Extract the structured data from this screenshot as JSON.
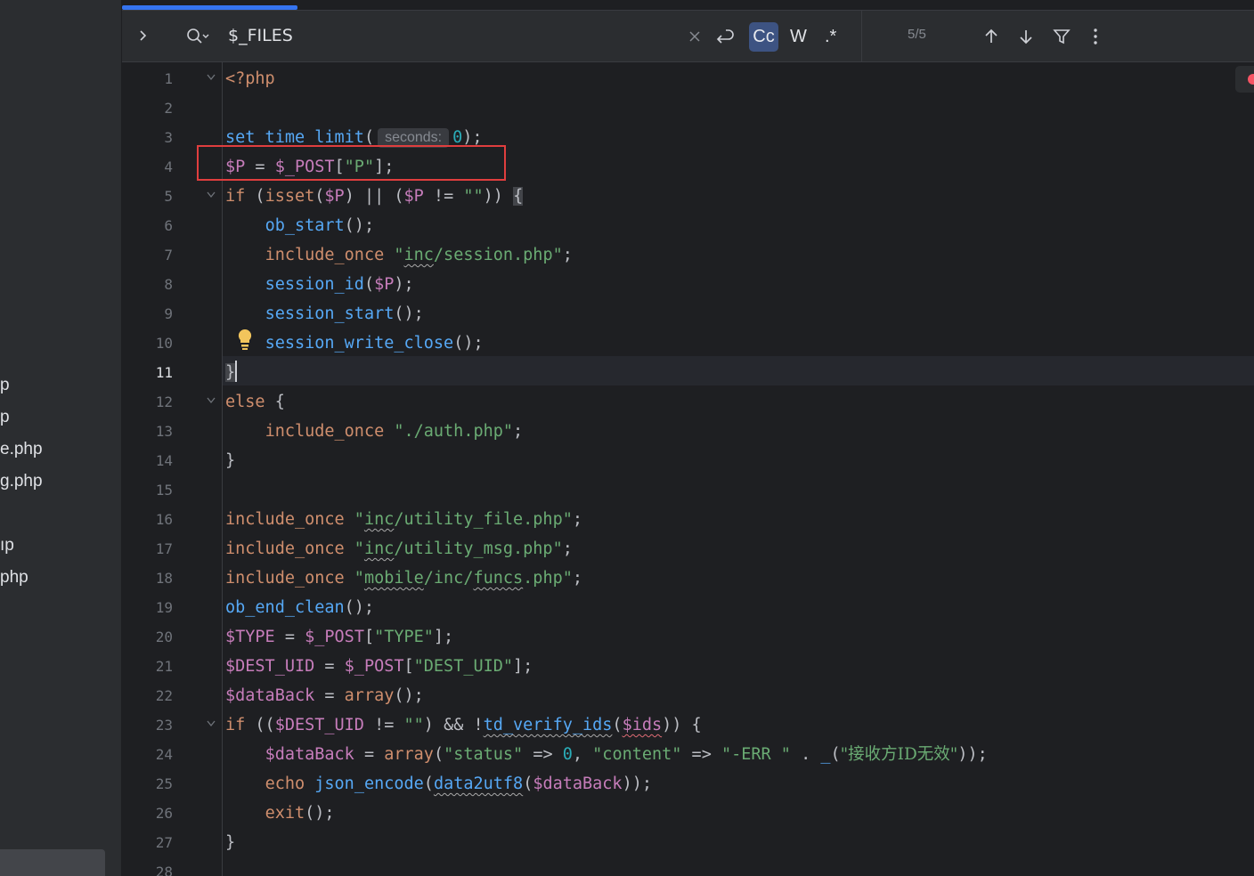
{
  "sidebar": {
    "items": [
      {
        "label": "p"
      },
      {
        "label": "p"
      },
      {
        "label": "e.php"
      },
      {
        "label": "g.php"
      },
      {
        "label": "ıp"
      },
      {
        "label": "php"
      }
    ]
  },
  "findbar": {
    "query": "$_FILES",
    "match_count": "5/5",
    "case_label": "Cc",
    "words_label": "W",
    "regex_label": ".*"
  },
  "gutter": {
    "line_numbers": [
      "1",
      "2",
      "3",
      "4",
      "5",
      "6",
      "7",
      "8",
      "9",
      "10",
      "11",
      "12",
      "13",
      "14",
      "15",
      "16",
      "17",
      "18",
      "19",
      "20",
      "21",
      "22",
      "23",
      "24",
      "25",
      "26",
      "27",
      "28"
    ],
    "current_line": "11"
  },
  "inlay_hint": "seconds:",
  "colors": {
    "keyword": "#cf8e6d",
    "function": "#56a8f5",
    "variable": "#c77dbb",
    "string": "#6aab73",
    "number": "#2aacb8",
    "accent": "#3574f0",
    "highlight_box": "#e03e3e"
  },
  "code": {
    "l1": "<?php",
    "l3a": "set_time_limit",
    "l3b": "(",
    "l3c": "0",
    "l3d": ");",
    "l4a": "$P",
    "l4b": " = ",
    "l4c": "$_POST",
    "l4d": "[",
    "l4e": "\"P\"",
    "l4f": "];",
    "l5a": "if",
    "l5b": " (",
    "l5c": "isset",
    "l5d": "(",
    "l5e": "$P",
    "l5f": ") || (",
    "l5g": "$P",
    "l5h": " != ",
    "l5i": "\"\"",
    "l5j": ")) ",
    "l5k": "{",
    "l6a": "ob_start",
    "l6b": "();",
    "l7a": "include_once",
    "l7b": "\"",
    "l7c": "inc",
    "l7d": "/session.php\"",
    "l7e": ";",
    "l8a": "session_id",
    "l8b": "(",
    "l8c": "$P",
    "l8d": ");",
    "l9a": "session_start",
    "l9b": "();",
    "l10a": "session_write_close",
    "l10b": "();",
    "l11": "}",
    "l12a": "else",
    "l12b": " {",
    "l13a": "include_once",
    "l13b": "\"./auth.php\"",
    "l13c": ";",
    "l14": "}",
    "l16a": "include_once",
    "l16b": "\"",
    "l16c": "inc",
    "l16d": "/utility_file.php\"",
    "l16e": ";",
    "l17a": "include_once",
    "l17b": "\"",
    "l17c": "inc",
    "l17d": "/utility_msg.php\"",
    "l17e": ";",
    "l18a": "include_once",
    "l18b": "\"",
    "l18c": "mobile",
    "l18d": "/inc/",
    "l18e": "funcs",
    "l18f": ".php\"",
    "l18g": ";",
    "l19a": "ob_end_clean",
    "l19b": "();",
    "l20a": "$TYPE",
    "l20b": " = ",
    "l20c": "$_POST",
    "l20d": "[",
    "l20e": "\"TYPE\"",
    "l20f": "];",
    "l21a": "$DEST_UID",
    "l21b": " = ",
    "l21c": "$_POST",
    "l21d": "[",
    "l21e": "\"DEST_UID\"",
    "l21f": "];",
    "l22a": "$dataBack",
    "l22b": " = ",
    "l22c": "array",
    "l22d": "();",
    "l23a": "if",
    "l23b": " ((",
    "l23c": "$DEST_UID",
    "l23d": " != ",
    "l23e": "\"\"",
    "l23f": ") && !",
    "l23g": "td_verify_ids",
    "l23h": "(",
    "l23i": "$ids",
    "l23j": ")) {",
    "l24a": "$dataBack",
    "l24b": " = ",
    "l24c": "array",
    "l24d": "(",
    "l24e": "\"status\"",
    "l24f": " => ",
    "l24g": "0",
    "l24h": ", ",
    "l24i": "\"content\"",
    "l24j": " => ",
    "l24k": "\"-ERR \"",
    "l24l": " . ",
    "l24m": "_",
    "l24n": "(",
    "l24o": "\"接收方ID无效\"",
    "l24p": "));",
    "l25a": "echo",
    "l25b": " ",
    "l25c": "json_encode",
    "l25d": "(",
    "l25e": "data2utf8",
    "l25f": "(",
    "l25g": "$dataBack",
    "l25h": "));",
    "l26a": "exit",
    "l26b": "();",
    "l27": "}"
  }
}
